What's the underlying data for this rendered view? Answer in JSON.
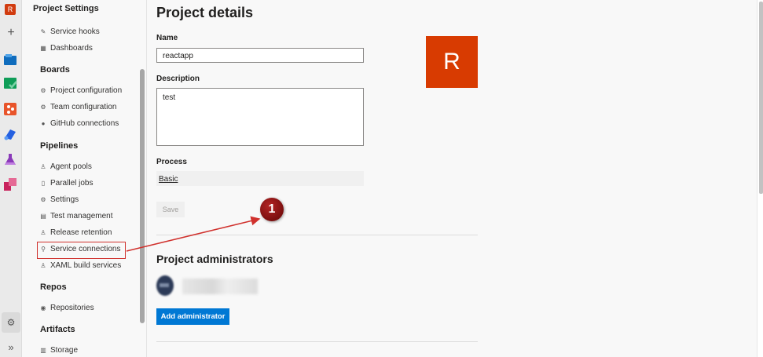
{
  "rail": {
    "avatar_letter": "R",
    "plus": "+",
    "settings_glyph": "⚙",
    "expand_glyph": "»",
    "icons": [
      "overview-icon",
      "boards-icon",
      "repos-icon",
      "pipelines-icon",
      "test-plans-icon",
      "artifacts-icon"
    ]
  },
  "nav": {
    "header": "Project Settings",
    "general_items": [
      {
        "label": "Service hooks",
        "icon": "service-hooks-icon"
      },
      {
        "label": "Dashboards",
        "icon": "dashboards-icon"
      }
    ],
    "sections": [
      {
        "title": "Boards",
        "items": [
          {
            "label": "Project configuration",
            "icon": "project-config-icon"
          },
          {
            "label": "Team configuration",
            "icon": "team-config-icon"
          },
          {
            "label": "GitHub connections",
            "icon": "github-icon"
          }
        ]
      },
      {
        "title": "Pipelines",
        "items": [
          {
            "label": "Agent pools",
            "icon": "agent-pools-icon"
          },
          {
            "label": "Parallel jobs",
            "icon": "parallel-jobs-icon"
          },
          {
            "label": "Settings",
            "icon": "gear-icon"
          },
          {
            "label": "Test management",
            "icon": "test-management-icon"
          },
          {
            "label": "Release retention",
            "icon": "release-retention-icon"
          },
          {
            "label": "Service connections",
            "icon": "service-connections-icon"
          },
          {
            "label": "XAML build services",
            "icon": "xaml-build-icon"
          }
        ]
      },
      {
        "title": "Repos",
        "items": [
          {
            "label": "Repositories",
            "icon": "repositories-icon"
          }
        ]
      },
      {
        "title": "Artifacts",
        "items": [
          {
            "label": "Storage",
            "icon": "storage-icon"
          }
        ]
      }
    ]
  },
  "main": {
    "title": "Project details",
    "name_label": "Name",
    "name_value": "reactapp",
    "description_label": "Description",
    "description_value": "test",
    "process_label": "Process",
    "process_value": "Basic",
    "save_label": "Save",
    "project_logo_letter": "R",
    "admins_title": "Project administrators",
    "add_admin_label": "Add administrator"
  },
  "annotation": {
    "marker_number": "1"
  },
  "colors": {
    "accent": "#0078d4",
    "project_tile": "#d83b01",
    "annotation": "#d0312d",
    "marker": "#8b1a1a"
  }
}
